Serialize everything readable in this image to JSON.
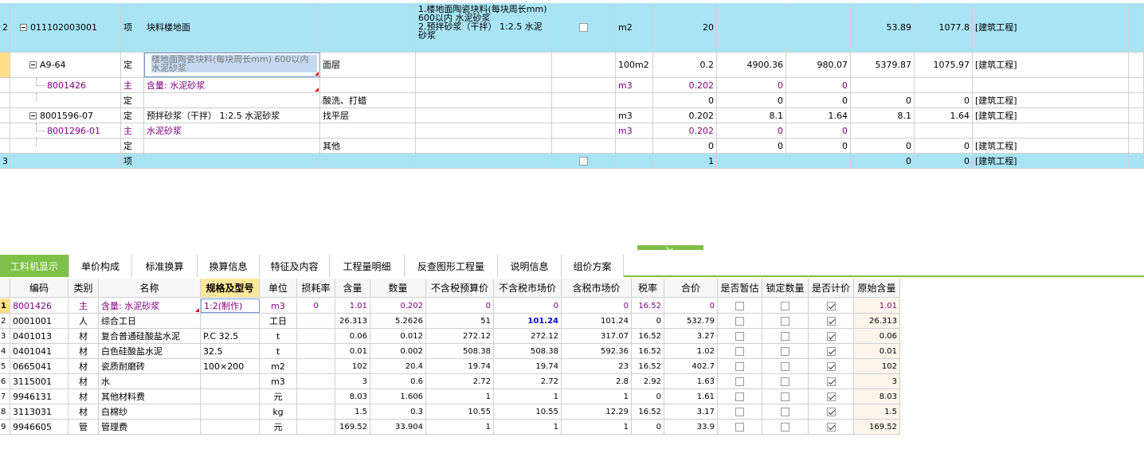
{
  "top_rows": [
    {
      "kind": "item",
      "row_no": "2",
      "code": "011102003001",
      "type": "项",
      "name": "块料楼地面",
      "spec": "",
      "feature": "1.楼地面陶瓷块料(每块周长mm) 600以内 水泥砂浆\n2.预拌砂浆（干拌） 1:2.5 水泥砂浆",
      "unit": "m2",
      "qty": "20",
      "c1": "",
      "c2": "",
      "c3": "53.89",
      "c4": "1077.8",
      "prof": "[建筑工程]"
    },
    {
      "kind": "sub",
      "row_no": "",
      "code": "A9-64",
      "type": "定",
      "name": "楼地面陶瓷块料(每块周长mm) 600以内 水泥砂浆",
      "spec": "面层",
      "feature": "",
      "unit": "100m2",
      "qty": "0.2",
      "c1": "4900.36",
      "c2": "980.07",
      "c3": "5379.87",
      "c4": "1075.97",
      "prof": "[建筑工程]"
    },
    {
      "kind": "material",
      "row_no": "",
      "code": "8001426",
      "type": "主",
      "name": "含量: 水泥砂浆",
      "spec": "",
      "feature": "",
      "unit": "m3",
      "qty": "0.202",
      "c1": "0",
      "c2": "0",
      "c3": "",
      "c4": "",
      "prof": ""
    },
    {
      "kind": "sub",
      "row_no": "",
      "code": "",
      "type": "定",
      "name": "",
      "spec": "酸洗、打蜡",
      "feature": "",
      "unit": "",
      "qty": "0",
      "c1": "0",
      "c2": "0",
      "c3": "0",
      "c4": "0",
      "prof": "[建筑工程]"
    },
    {
      "kind": "sub",
      "row_no": "",
      "code": "8001596-07",
      "type": "定",
      "name": "预拌砂浆（干拌） 1:2.5 水泥砂浆",
      "spec": "找平层",
      "feature": "",
      "unit": "m3",
      "qty": "0.202",
      "c1": "8.1",
      "c2": "1.64",
      "c3": "8.1",
      "c4": "1.64",
      "prof": "[建筑工程]"
    },
    {
      "kind": "material",
      "row_no": "",
      "code": "8001296-01",
      "type": "主",
      "name": "水泥砂浆",
      "spec": "",
      "feature": "",
      "unit": "m3",
      "qty": "0.202",
      "c1": "0",
      "c2": "0",
      "c3": "",
      "c4": "",
      "prof": ""
    },
    {
      "kind": "sub",
      "row_no": "",
      "code": "",
      "type": "定",
      "name": "",
      "spec": "其他",
      "feature": "",
      "unit": "",
      "qty": "0",
      "c1": "0",
      "c2": "0",
      "c3": "0",
      "c4": "0",
      "prof": "[建筑工程]"
    },
    {
      "kind": "item",
      "row_no": "3",
      "code": "",
      "type": "项",
      "name": "",
      "spec": "",
      "feature": "",
      "unit": "",
      "qty": "1",
      "c1": "",
      "c2": "",
      "c3": "0",
      "c4": "0",
      "prof": "[建筑工程]"
    }
  ],
  "tabs": [
    "工料机显示",
    "单价构成",
    "标准换算",
    "换算信息",
    "特征及内容",
    "工程量明细",
    "反查图形工程量",
    "说明信息",
    "组价方案"
  ],
  "bottom_headers": [
    "编码",
    "类别",
    "名称",
    "规格及型号",
    "单位",
    "损耗率",
    "含量",
    "数量",
    "不含税预算价",
    "不含税市场价",
    "含税市场价",
    "税率",
    "合价",
    "是否暂估",
    "锁定数量",
    "是否计价",
    "原始含量"
  ],
  "bottom_rows": [
    {
      "no": "1",
      "code": "8001426",
      "cat": "主",
      "name": "含量: 水泥砂浆",
      "spec": "1:2(制作)",
      "unit": "m3",
      "loss": "0",
      "content": "1.01",
      "qty": "0.202",
      "budget": "0",
      "market": "0",
      "tax_market": "0",
      "rate": "16.52",
      "total": "0",
      "est": false,
      "lock": false,
      "priced": true,
      "orig": "1.01"
    },
    {
      "no": "2",
      "code": "0001001",
      "cat": "人",
      "name": "综合工日",
      "spec": "",
      "unit": "工日",
      "loss": "",
      "content": "26.313",
      "qty": "5.2626",
      "budget": "51",
      "market": "101.24",
      "tax_market": "101.24",
      "rate": "0",
      "total": "532.79",
      "est": false,
      "lock": false,
      "priced": true,
      "orig": "26.313"
    },
    {
      "no": "3",
      "code": "0401013",
      "cat": "材",
      "name": "复合普通硅酸盐水泥",
      "spec": "P.C 32.5",
      "unit": "t",
      "loss": "",
      "content": "0.06",
      "qty": "0.012",
      "budget": "272.12",
      "market": "272.12",
      "tax_market": "317.07",
      "rate": "16.52",
      "total": "3.27",
      "est": false,
      "lock": false,
      "priced": true,
      "orig": "0.06"
    },
    {
      "no": "4",
      "code": "0401041",
      "cat": "材",
      "name": "白色硅酸盐水泥",
      "spec": "32.5",
      "unit": "t",
      "loss": "",
      "content": "0.01",
      "qty": "0.002",
      "budget": "508.38",
      "market": "508.38",
      "tax_market": "592.36",
      "rate": "16.52",
      "total": "1.02",
      "est": false,
      "lock": false,
      "priced": true,
      "orig": "0.01"
    },
    {
      "no": "5",
      "code": "0665041",
      "cat": "材",
      "name": "瓷质耐磨砖",
      "spec": "100×200",
      "unit": "m2",
      "loss": "",
      "content": "102",
      "qty": "20.4",
      "budget": "19.74",
      "market": "19.74",
      "tax_market": "23",
      "rate": "16.52",
      "total": "402.7",
      "est": false,
      "lock": false,
      "priced": true,
      "orig": "102"
    },
    {
      "no": "6",
      "code": "3115001",
      "cat": "材",
      "name": "水",
      "spec": "",
      "unit": "m3",
      "loss": "",
      "content": "3",
      "qty": "0.6",
      "budget": "2.72",
      "market": "2.72",
      "tax_market": "2.8",
      "rate": "2.92",
      "total": "1.63",
      "est": false,
      "lock": false,
      "priced": true,
      "orig": "3"
    },
    {
      "no": "7",
      "code": "9946131",
      "cat": "材",
      "name": "其他材料费",
      "spec": "",
      "unit": "元",
      "loss": "",
      "content": "8.03",
      "qty": "1.606",
      "budget": "1",
      "market": "1",
      "tax_market": "1",
      "rate": "0",
      "total": "1.61",
      "est": false,
      "lock": false,
      "priced": true,
      "orig": "8.03"
    },
    {
      "no": "8",
      "code": "3113031",
      "cat": "材",
      "name": "白棉纱",
      "spec": "",
      "unit": "kg",
      "loss": "",
      "content": "1.5",
      "qty": "0.3",
      "budget": "10.55",
      "market": "10.55",
      "tax_market": "12.29",
      "rate": "16.52",
      "total": "3.17",
      "est": false,
      "lock": false,
      "priced": true,
      "orig": "1.5"
    },
    {
      "no": "9",
      "code": "9946605",
      "cat": "管",
      "name": "管理费",
      "spec": "",
      "unit": "元",
      "loss": "",
      "content": "169.52",
      "qty": "33.904",
      "budget": "1",
      "market": "1",
      "tax_market": "1",
      "rate": "0",
      "total": "33.9",
      "est": false,
      "lock": false,
      "priced": true,
      "orig": "169.52"
    }
  ]
}
